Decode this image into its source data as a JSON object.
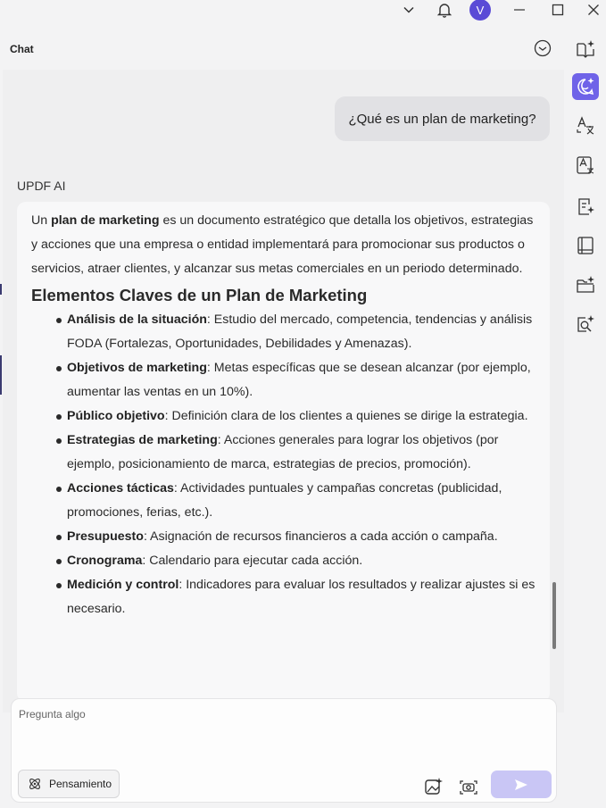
{
  "window": {
    "avatar_letter": "V"
  },
  "chat": {
    "title": "Chat",
    "user_message": "¿Qué es un plan de marketing?",
    "assistant_name": "UPDF AI",
    "answer": {
      "intro_prefix": "Un ",
      "intro_bold": "plan de marketing",
      "intro_rest": " es un documento estratégico que detalla los objetivos, estrategias y acciones que una empresa o entidad implementará para promocionar sus productos o servicios, atraer clientes, y alcanzar sus metas comerciales en un periodo determinado.",
      "heading": "Elementos Claves de un Plan de Marketing",
      "items": [
        {
          "term": "Análisis de la situación",
          "text": ": Estudio del mercado, competencia, tendencias y análisis FODA (Fortalezas, Oportunidades, Debilidades y Amenazas)."
        },
        {
          "term": "Objetivos de marketing",
          "text": ": Metas específicas que se desean alcanzar (por ejemplo, aumentar las ventas en un 10%)."
        },
        {
          "term": "Público objetivo",
          "text": ": Definición clara de los clientes a quienes se dirige la estrategia."
        },
        {
          "term": "Estrategias de marketing",
          "text": ": Acciones generales para lograr los objetivos (por ejemplo, posicionamiento de marca, estrategias de precios, promoción)."
        },
        {
          "term": "Acciones tácticas",
          "text": ": Actividades puntuales y campañas concretas (publicidad, promociones, ferias, etc.)."
        },
        {
          "term": "Presupuesto",
          "text": ": Asignación de recursos financieros a cada acción o campaña."
        },
        {
          "term": "Cronograma",
          "text": ": Calendario para ejecutar cada acción."
        },
        {
          "term": "Medición y control",
          "text": ": Indicadores para evaluar los resultados y realizar ajustes si es necesario."
        }
      ]
    }
  },
  "composer": {
    "placeholder": "Pregunta algo",
    "value": "",
    "thinking_label": "Pensamiento"
  },
  "colors": {
    "accent": "#6f63e8",
    "send_disabled": "#c9c6f5",
    "avatar": "#5a4bd6"
  }
}
